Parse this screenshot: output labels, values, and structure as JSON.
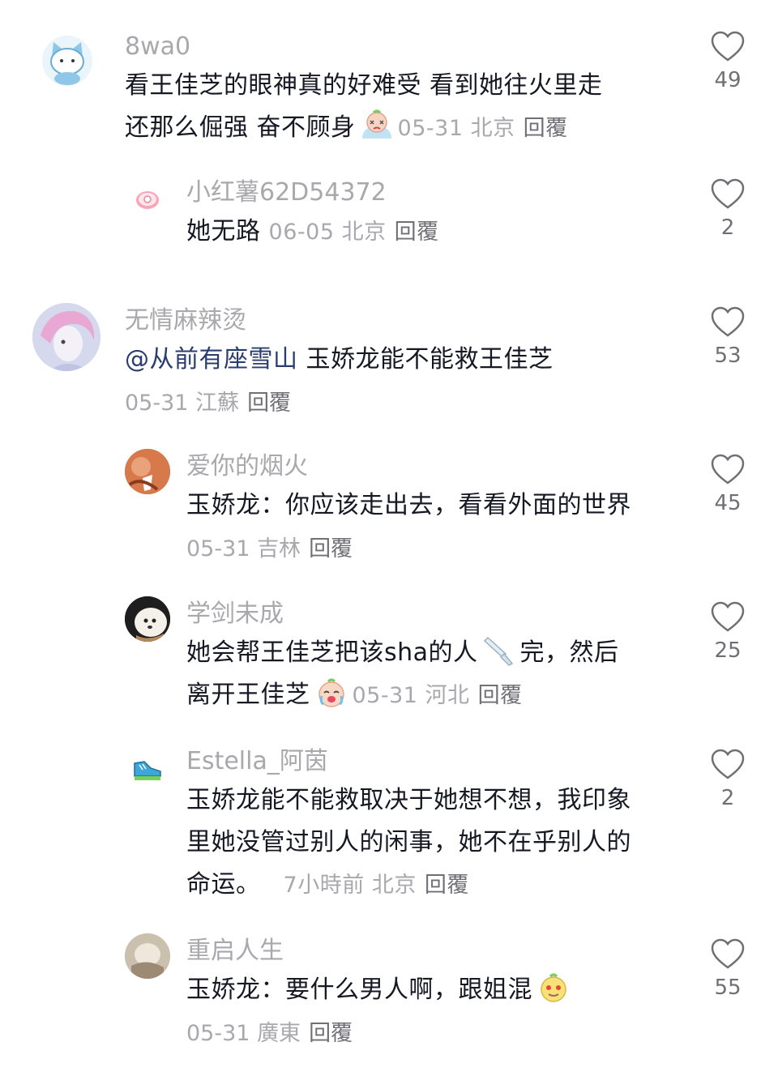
{
  "comments": [
    {
      "username": "8wa0",
      "text": "看王佳芝的眼神真的好难受 看到她往火里走",
      "text2": "还那么倔强 奋不顾身",
      "date": "05-31",
      "location": "北京",
      "reply": "回覆",
      "likes": "49"
    },
    {
      "username": "小红薯62D54372",
      "text": "她无路",
      "date": "06-05",
      "location": "北京",
      "reply": "回覆",
      "likes": "2"
    },
    {
      "username": "无情麻辣烫",
      "mention": "@从前有座雪山",
      "text": "玉娇龙能不能救王佳芝",
      "date": "05-31",
      "location": "江蘇",
      "reply": "回覆",
      "likes": "53"
    },
    {
      "username": "爱你的烟火",
      "text": "玉娇龙：你应该走出去，看看外面的世界",
      "date": "05-31",
      "location": "吉林",
      "reply": "回覆",
      "likes": "45"
    },
    {
      "username": "学剑未成",
      "text": "她会帮王佳芝把该sha的人",
      "text_after": "完，然后",
      "text2": "离开王佳芝",
      "date": "05-31",
      "location": "河北",
      "reply": "回覆",
      "likes": "25"
    },
    {
      "username": "Estella_阿茵",
      "text": "玉娇龙能不能救取决于她想不想，我印象",
      "text2": "里她没管过别人的闲事，她不在乎别人的",
      "text3": "命运。",
      "date": "7小時前",
      "location": "北京",
      "reply": "回覆",
      "likes": "2"
    },
    {
      "username": "重启人生",
      "text": "玉娇龙：要什么男人啊，跟姐混",
      "date": "05-31",
      "location": "廣東",
      "reply": "回覆",
      "likes": "55"
    }
  ],
  "icons": {
    "like": "heart-outline-icon"
  }
}
